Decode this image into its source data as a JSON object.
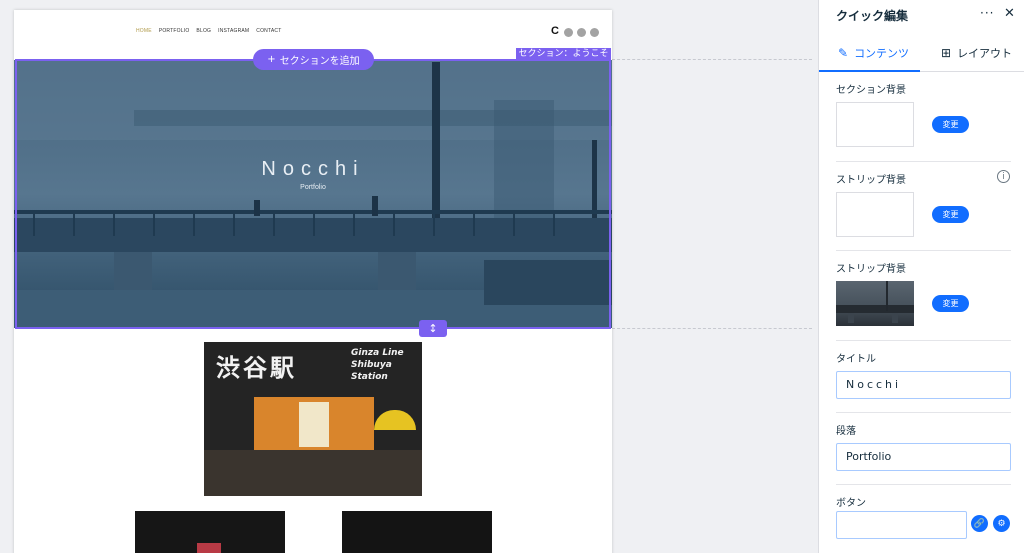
{
  "site": {
    "nav": [
      "HOME",
      "PORTFOLIO",
      "BLOG",
      "INSTAGRAM",
      "CONTACT"
    ],
    "logo_letter": "C",
    "hero_title": "Nocchi",
    "hero_subtitle": "Portfolio",
    "sign_big": "渋谷駅",
    "sign_lines": [
      "Ginza Line",
      "Shibuya",
      "Station"
    ]
  },
  "editor": {
    "add_section": "セクションを追加",
    "add_icon": "+",
    "section_label": "セクション：ようこそ",
    "resize_icon": "↕"
  },
  "panel": {
    "title": "クイック編集",
    "more_icon": "···",
    "close_icon": "✕",
    "tabs": [
      {
        "label": "コンテンツ",
        "icon": "✎"
      },
      {
        "label": "レイアウト",
        "icon": "⊞"
      }
    ],
    "section_bg": {
      "label": "セクション背景",
      "button": "変更"
    },
    "strip_bg_1": {
      "label": "ストリップ背景",
      "button": "変更",
      "info_icon": "i"
    },
    "strip_bg_2": {
      "label": "ストリップ背景",
      "button": "変更"
    },
    "title_field": {
      "label": "タイトル",
      "value": "Nocchi"
    },
    "paragraph_field": {
      "label": "段落",
      "value": "Portfolio"
    },
    "button_field": {
      "label": "ボタン",
      "value": "",
      "link_icon": "🔗",
      "settings_icon": "⚙"
    }
  },
  "colors": {
    "accent": "#7b61f0",
    "primary": "#116dff",
    "panel_text": "#162d3d",
    "hero": "#47667f"
  }
}
